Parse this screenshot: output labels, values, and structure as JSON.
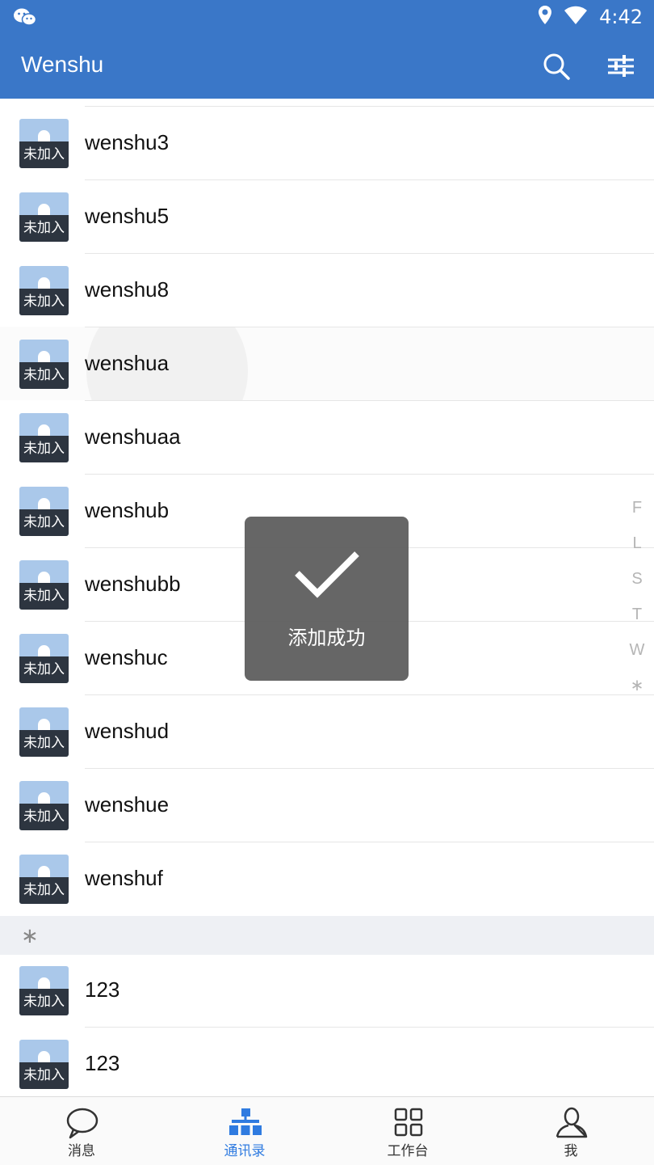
{
  "status": {
    "time": "4:42"
  },
  "appbar": {
    "title": "Wenshu"
  },
  "contacts": [
    {
      "name": "wenshu3",
      "tag": "未加入"
    },
    {
      "name": "wenshu5",
      "tag": "未加入"
    },
    {
      "name": "wenshu8",
      "tag": "未加入"
    },
    {
      "name": "wenshua",
      "tag": "未加入"
    },
    {
      "name": "wenshuaa",
      "tag": "未加入"
    },
    {
      "name": "wenshub",
      "tag": "未加入"
    },
    {
      "name": "wenshubb",
      "tag": "未加入"
    },
    {
      "name": "wenshuc",
      "tag": "未加入"
    },
    {
      "name": "wenshud",
      "tag": "未加入"
    },
    {
      "name": "wenshue",
      "tag": "未加入"
    },
    {
      "name": "wenshuf",
      "tag": "未加入"
    }
  ],
  "section": {
    "label": "∗"
  },
  "contacts2": [
    {
      "name": "123",
      "tag": "未加入"
    },
    {
      "name": "123",
      "tag": "未加入"
    }
  ],
  "index": [
    "F",
    "L",
    "S",
    "T",
    "W",
    "∗"
  ],
  "toast": {
    "text": "添加成功"
  },
  "tabs": [
    {
      "label": "消息",
      "icon": "chat-bubble-icon"
    },
    {
      "label": "通讯录",
      "icon": "org-chart-icon",
      "active": true
    },
    {
      "label": "工作台",
      "icon": "grid-icon"
    },
    {
      "label": "我",
      "icon": "person-icon"
    }
  ],
  "colors": {
    "primary": "#3a77c8",
    "active_tab": "#2f7be0",
    "avatar_bar": "#2d3540",
    "avatar_bg": "#aac8ea"
  }
}
